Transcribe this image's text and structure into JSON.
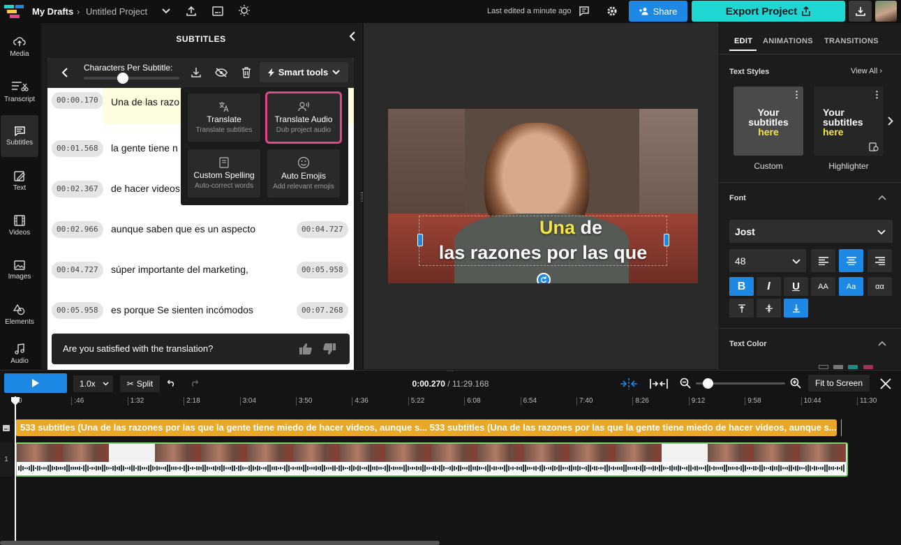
{
  "topbar": {
    "my_drafts": "My Drafts",
    "project_name": "Untitled Project",
    "last_edited": "Last edited a minute ago",
    "share_label": "Share",
    "export_label": "Export Project"
  },
  "rail": [
    "Media",
    "Transcript",
    "Subtitles",
    "Text",
    "Videos",
    "Images",
    "Elements",
    "Audio"
  ],
  "subtitles_panel": {
    "title": "SUBTITLES",
    "chars_label": "Characters Per Subtitle:",
    "smart_tools_label": "Smart tools",
    "rows": [
      {
        "start": "00:00.170",
        "text": "Una de las razo",
        "end": ""
      },
      {
        "start": "00:01.568",
        "text": "la gente tiene n",
        "end": ""
      },
      {
        "start": "00:02.367",
        "text": "de hacer videos",
        "end": ""
      },
      {
        "start": "00:02.966",
        "text": "aunque saben que es un aspecto",
        "end": "00:04.727"
      },
      {
        "start": "00:04.727",
        "text": "súper importante del marketing,",
        "end": "00:05.958"
      },
      {
        "start": "00:05.958",
        "text": "es porque Se sienten incómodos",
        "end": "00:07.268"
      }
    ],
    "feedback": "Are you satisfied with the translation?"
  },
  "smart_tools": [
    {
      "title": "Translate",
      "sub": "Translate subtitles",
      "icon": "translate-icon"
    },
    {
      "title": "Translate Audio",
      "sub": "Dub project audio",
      "icon": "voice-icon"
    },
    {
      "title": "Custom Spelling",
      "sub": "Auto-correct words",
      "icon": "book-icon"
    },
    {
      "title": "Auto Emojis",
      "sub": "Add relevant emojis",
      "icon": "smile-icon"
    }
  ],
  "caption": {
    "line1_highlight": "Una",
    "line1_rest": "de",
    "line2": "las razones por las que"
  },
  "right_panel": {
    "tabs": [
      "EDIT",
      "ANIMATIONS",
      "TRANSITIONS"
    ],
    "text_styles": "Text Styles",
    "view_all": "View All",
    "styles": [
      {
        "l1": "Your",
        "l2": "subtitles",
        "l3": "here",
        "name": "Custom"
      },
      {
        "l1": "Your",
        "l2": "subtitles",
        "l3": "here",
        "name": "Highlighter"
      }
    ],
    "font_section": "Font",
    "font_name": "Jost",
    "font_size": "48",
    "aa_label": "AA",
    "aa2_label": "Aa",
    "ab_label": "αα",
    "text_color": "Text Color"
  },
  "timeline": {
    "speed": "1.0x",
    "split": "Split",
    "current_time": "0:00.270",
    "total_time": "11:29.168",
    "fit": "Fit to Screen",
    "ticks": [
      "0",
      ":46",
      "1:32",
      "2:18",
      "3:04",
      "3:50",
      "4:36",
      "5:22",
      "6:08",
      "6:54",
      "7:40",
      "8:26",
      "9:12",
      "9:58",
      "10:44",
      "11:30"
    ],
    "subtitle_track": "533 subtitles (Una de las razones por las que la gente tiene miedo de hacer videos, aunque s... 533 subtitles (Una de las razones por las que la gente tiene miedo de hacer videos, aunque s...",
    "track_number": "1"
  },
  "colors": {
    "accent_blue": "#1e88e5",
    "export_teal": "#1ed6d2",
    "highlight_yellow": "#f4e542",
    "subtitle_track": "#e9a826",
    "tool_highlight": "#e0478a"
  }
}
